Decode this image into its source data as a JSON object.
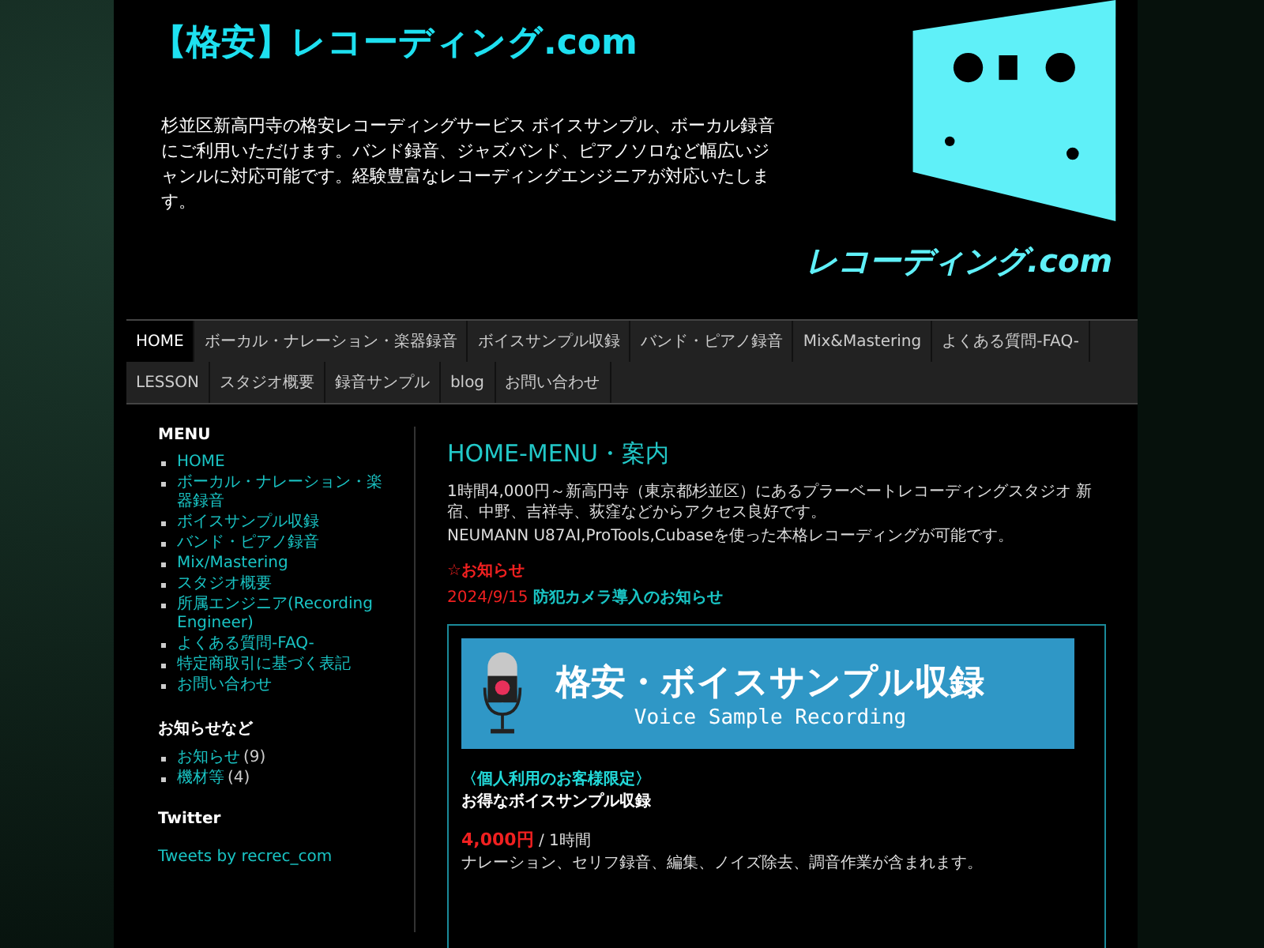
{
  "header": {
    "title": "【格安】レコーディング.com",
    "description": "杉並区新高円寺の格安レコーディングサービス ボイスサンプル、ボーカル録音にご利用いただけます。バンド録音、ジャズバンド、ピアノソロなど幅広いジャンルに対応可能です。経験豊富なレコーディングエンジニアが対応いたします。",
    "logo_text": "レコーディング.com"
  },
  "nav": {
    "tabs": [
      {
        "label": "HOME",
        "selected": true
      },
      {
        "label": "ボーカル・ナレーション・楽器録音",
        "selected": false
      },
      {
        "label": "ボイスサンプル収録",
        "selected": false
      },
      {
        "label": "バンド・ピアノ録音",
        "selected": false
      },
      {
        "label": "Mix&Mastering",
        "selected": false
      },
      {
        "label": "よくある質問-FAQ-",
        "selected": false
      },
      {
        "label": "LESSON",
        "selected": false
      },
      {
        "label": "スタジオ概要",
        "selected": false
      },
      {
        "label": "録音サンプル",
        "selected": false
      },
      {
        "label": "blog",
        "selected": false
      },
      {
        "label": "お問い合わせ",
        "selected": false
      }
    ]
  },
  "sidebar": {
    "sections": [
      {
        "kind": "list",
        "heading": "MENU",
        "items": [
          {
            "label": "HOME"
          },
          {
            "label": "ボーカル・ナレーション・楽器録音"
          },
          {
            "label": "ボイスサンプル収録"
          },
          {
            "label": "バンド・ピアノ録音"
          },
          {
            "label": "Mix/Mastering"
          },
          {
            "label": "スタジオ概要"
          },
          {
            "label": "所属エンジニア(Recording Engineer)"
          },
          {
            "label": "よくある質問-FAQ-"
          },
          {
            "label": "特定商取引に基づく表記"
          },
          {
            "label": "お問い合わせ"
          }
        ]
      },
      {
        "kind": "list",
        "heading": "お知らせなど",
        "items": [
          {
            "label": "お知らせ",
            "count": "(9)"
          },
          {
            "label": "機材等",
            "count": "(4)"
          }
        ]
      },
      {
        "kind": "link",
        "heading": "Twitter",
        "link": "Tweets by recrec_com"
      }
    ]
  },
  "main": {
    "heading": "HOME-MENU・案内",
    "paragraphs": [
      "1時間4,000円～新高円寺（東京都杉並区）にあるプラーベートレコーディングスタジオ 新宿、中野、吉祥寺、荻窪などからアクセス良好です。",
      "NEUMANN U87AI,ProTools,Cubaseを使った本格レコーディングが可能です。"
    ],
    "notice": {
      "heading": "☆お知らせ",
      "items": [
        {
          "date": "2024/9/15",
          "title": "防犯カメラ導入のお知らせ"
        }
      ]
    },
    "box": {
      "banner_title": "格安・ボイスサンプル収録",
      "banner_subtitle": "Voice Sample Recording",
      "tag": "〈個人利用のお客様限定〉",
      "subtitle": "お得なボイスサンプル収録",
      "price": "4,000円",
      "unit": "/ 1時間",
      "description": "ナレーション、セリフ録音、編集、ノイズ除去、調音作業が含まれます。"
    }
  }
}
